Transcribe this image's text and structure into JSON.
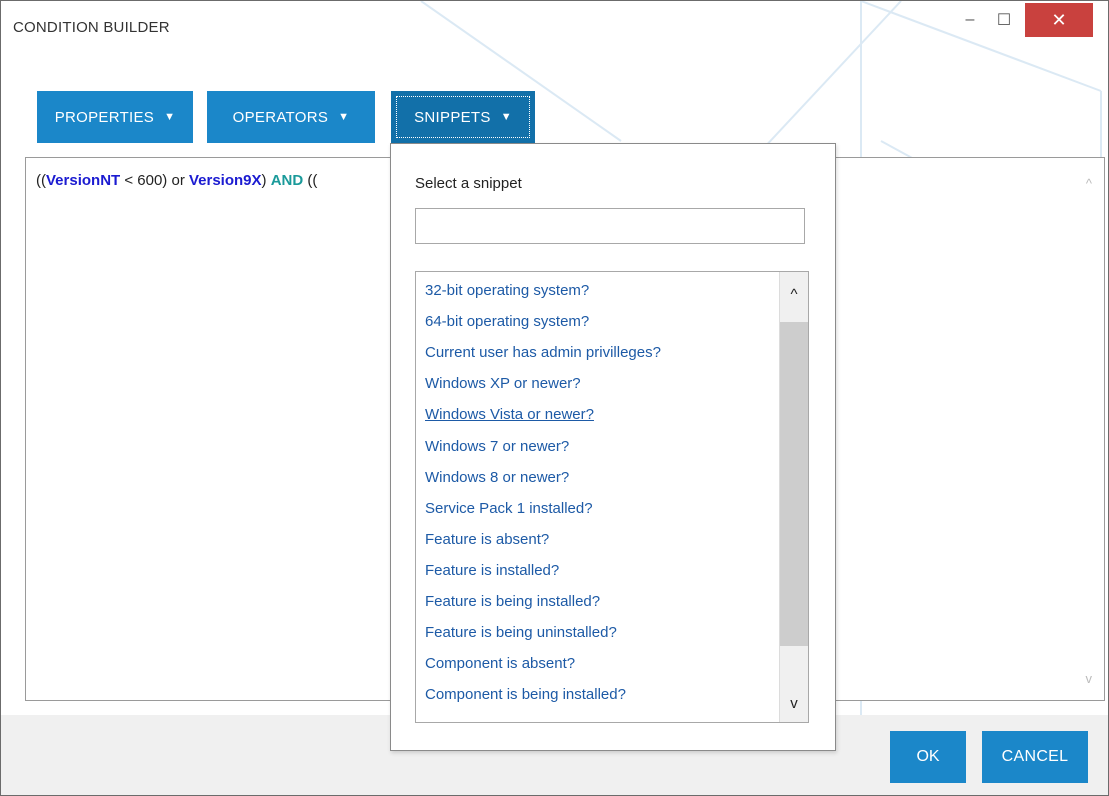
{
  "window": {
    "title": "CONDITION BUILDER",
    "minimize_glyph": "–",
    "maximize_glyph": "☐",
    "close_glyph": "✕"
  },
  "toolbar": {
    "properties_label": "PROPERTIES",
    "operators_label": "OPERATORS",
    "snippets_label": "SNIPPETS",
    "caret_glyph": "▼"
  },
  "editor": {
    "expression_parts": {
      "p1": "((",
      "p2": "VersionNT",
      "p3": " < 600) or ",
      "p4": "Version9X",
      "p5": ") ",
      "p6": "AND",
      "p7": " (("
    },
    "scroll_up_glyph": "^",
    "scroll_down_glyph": "v"
  },
  "snippets_popup": {
    "label": "Select a snippet",
    "search_value": "",
    "search_placeholder": "",
    "items": [
      {
        "label": "32-bit operating system?"
      },
      {
        "label": "64-bit operating system?"
      },
      {
        "label": "Current user has admin privilleges?"
      },
      {
        "label": "Windows XP or newer?"
      },
      {
        "label": "Windows Vista or newer?"
      },
      {
        "label": "Windows 7 or newer?"
      },
      {
        "label": "Windows 8 or newer?"
      },
      {
        "label": "Service Pack 1 installed?"
      },
      {
        "label": "Feature is absent?"
      },
      {
        "label": "Feature is installed?"
      },
      {
        "label": "Feature is being installed?"
      },
      {
        "label": "Feature is being uninstalled?"
      },
      {
        "label": "Component is absent?"
      },
      {
        "label": "Component is being installed?"
      }
    ],
    "hovered_item": "Windows Vista or newer?",
    "scroll_up_glyph": "^",
    "scroll_down_glyph": "v"
  },
  "footer": {
    "ok_label": "OK",
    "cancel_label": "CANCEL"
  },
  "colors": {
    "accent": "#1b87c9",
    "close": "#c9413e",
    "link": "#1d5aa6",
    "property_keyword": "#1b1bd1",
    "and_keyword": "#1a9a9a"
  }
}
